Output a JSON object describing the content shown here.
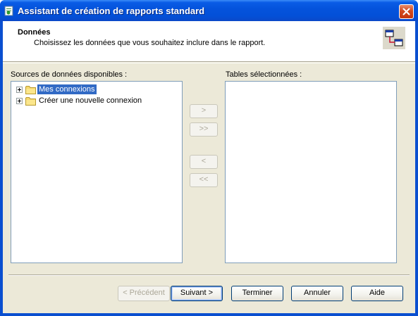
{
  "window": {
    "title": "Assistant de création de rapports standard",
    "accent_color": "#0a4fd0",
    "title_icon": "report-wizard-icon",
    "close_icon": "close-icon"
  },
  "header": {
    "title": "Données",
    "subtitle": "Choisissez les données que vous souhaitez inclure dans le rapport.",
    "icon": "data-tables-icon"
  },
  "sources": {
    "label": "Sources de données disponibles :",
    "items": [
      {
        "label": "Mes connexions",
        "icon": "folder-icon",
        "expander": "plus-icon",
        "selected": true
      },
      {
        "label": "Créer une nouvelle connexion",
        "icon": "folder-icon",
        "expander": "plus-icon",
        "selected": false
      }
    ]
  },
  "selected_tables": {
    "label": "Tables sélectionnées :",
    "items": []
  },
  "transfer_buttons": {
    "add": ">",
    "add_all": ">>",
    "remove": "<",
    "remove_all": "<<"
  },
  "footer": {
    "previous": "< Précédent",
    "next": "Suivant >",
    "finish": "Terminer",
    "cancel": "Annuler",
    "help": "Aide"
  }
}
